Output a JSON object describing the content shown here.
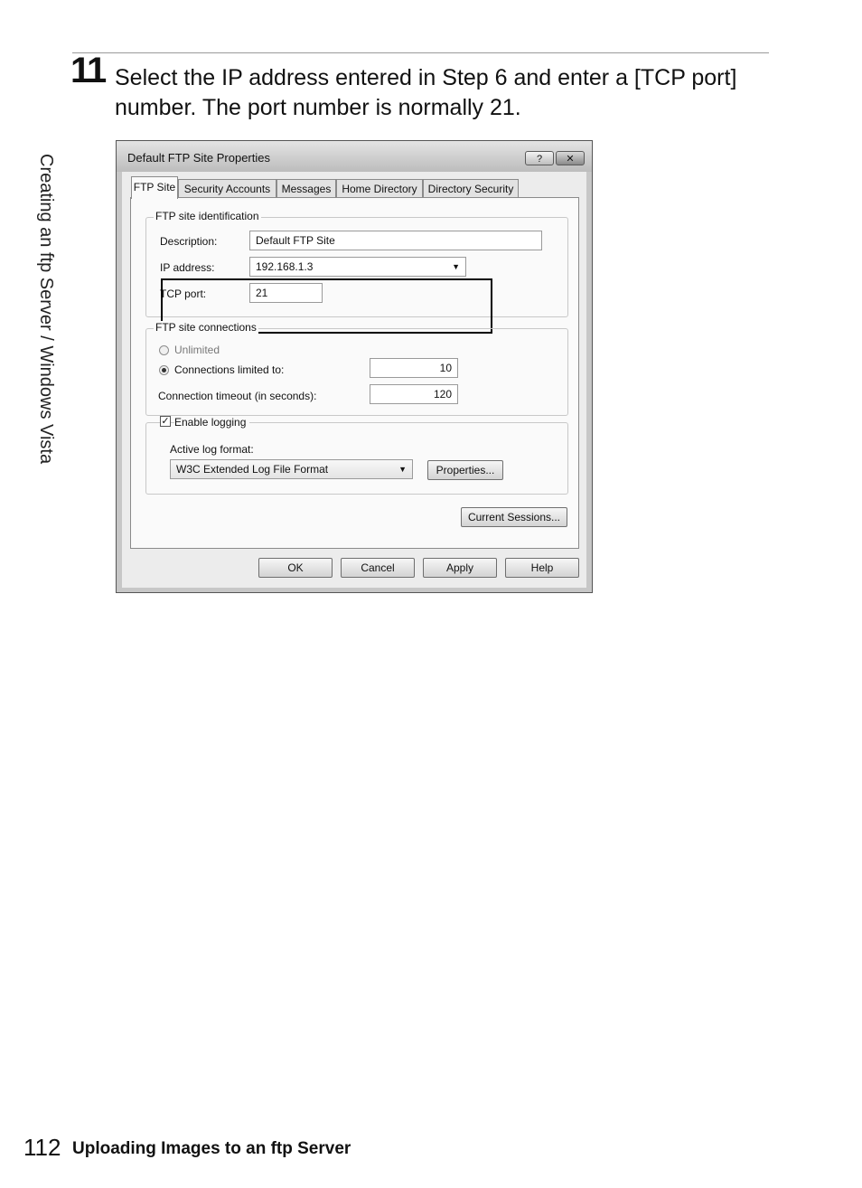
{
  "step": {
    "number": "11",
    "text": "Select the IP address entered in Step 6 and enter a [TCP port] number.  The port number is normally 21."
  },
  "side_label": "Creating an ftp Server / Windows Vista",
  "dialog": {
    "title": "Default FTP Site Properties",
    "help_button": "?",
    "close_button": "✕",
    "tabs": [
      "FTP Site",
      "Security Accounts",
      "Messages",
      "Home Directory",
      "Directory Security"
    ],
    "identification": {
      "legend": "FTP site identification",
      "description_label": "Description:",
      "description_value": "Default FTP Site",
      "ip_label": "IP address:",
      "ip_value": "192.168.1.3",
      "tcp_label": "TCP port:",
      "tcp_value": "21"
    },
    "connections": {
      "legend": "FTP site connections",
      "unlimited_label": "Unlimited",
      "limited_label": "Connections limited to:",
      "limited_value": "10",
      "timeout_label": "Connection timeout (in seconds):",
      "timeout_value": "120"
    },
    "logging": {
      "enable_label": "Enable logging",
      "format_label": "Active log format:",
      "format_value": "W3C Extended Log File Format",
      "properties_button": "Properties..."
    },
    "current_sessions_button": "Current Sessions...",
    "buttons": {
      "ok": "OK",
      "cancel": "Cancel",
      "apply": "Apply",
      "help": "Help"
    }
  },
  "footer": {
    "page_number": "112",
    "title": "Uploading Images to an ftp Server"
  }
}
